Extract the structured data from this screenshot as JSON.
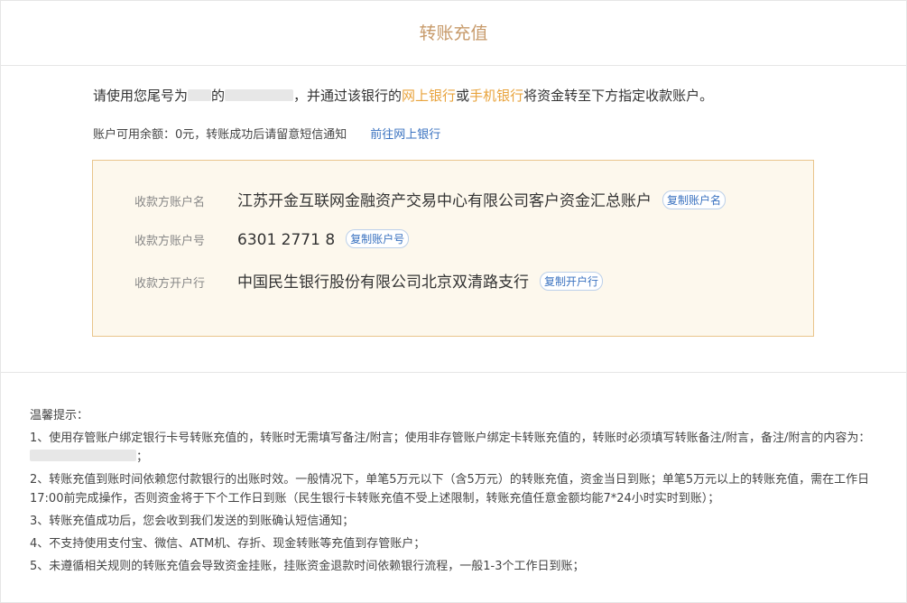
{
  "page": {
    "title": "转账充值"
  },
  "instruction": {
    "prefix": "请使用您尾号为",
    "mid": "的",
    "suffix_a": "，并通过该银行的",
    "online_bank": "网上银行",
    "or": "或",
    "mobile_bank": "手机银行",
    "suffix_b": "将资金转至下方指定收款账户。"
  },
  "balance": {
    "text": "账户可用余额：0元，转账成功后请留意短信通知",
    "link": "前往网上银行"
  },
  "payee": {
    "name_label": "收款方账户名",
    "name_value": "江苏开金互联网金融资产交易中心有限公司客户资金汇总账户",
    "name_copy": "复制账户名",
    "number_label": "收款方账户号",
    "number_value": "6301 2771 8",
    "number_copy": "复制账户号",
    "bank_label": "收款方开户行",
    "bank_value": "中国民生银行股份有限公司北京双清路支行",
    "bank_copy": "复制开户行"
  },
  "tips": {
    "heading": "温馨提示：",
    "t1a": "1、使用存管账户绑定银行卡号转账充值的，转账时无需填写备注/附言；使用非存管账户绑定卡转账充值的，转账时必须填写转账备注/附言，备注/附言的内容为：",
    "t1b": "；",
    "t2": "2、转账充值到账时间依赖您付款银行的出账时效。一般情况下，单笔5万元以下（含5万元）的转账充值，资金当日到账；单笔5万元以上的转账充值，需在工作日17:00前完成操作，否则资金将于下个工作日到账（民生银行卡转账充值不受上述限制，转账充值任意金额均能7*24小时实时到账）；",
    "t3": "3、转账充值成功后，您会收到我们发送的到账确认短信通知；",
    "t4": "4、不支持使用支付宝、微信、ATM机、存折、现金转账等充值到存管账户；",
    "t5": "5、未遵循相关规则的转账充值会导致资金挂账，挂账资金退款时间依赖银行流程，一般1-3个工作日到账；"
  }
}
